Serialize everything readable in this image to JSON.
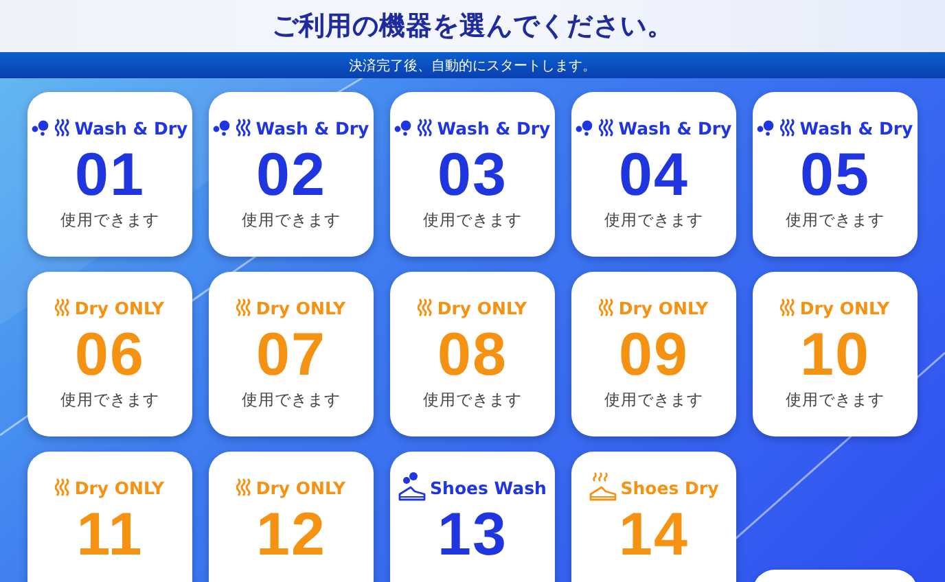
{
  "title": "ご利用の機器を選んでください。",
  "notice": "決済完了後、自動的にスタートします。",
  "machines": [
    {
      "kind": "wash_dry",
      "label": "Wash & Dry",
      "number": "01",
      "status": "使用できます"
    },
    {
      "kind": "wash_dry",
      "label": "Wash & Dry",
      "number": "02",
      "status": "使用できます"
    },
    {
      "kind": "wash_dry",
      "label": "Wash & Dry",
      "number": "03",
      "status": "使用できます"
    },
    {
      "kind": "wash_dry",
      "label": "Wash & Dry",
      "number": "04",
      "status": "使用できます"
    },
    {
      "kind": "wash_dry",
      "label": "Wash & Dry",
      "number": "05",
      "status": "使用できます"
    },
    {
      "kind": "dry_only",
      "label": "Dry ONLY",
      "number": "06",
      "status": "使用できます"
    },
    {
      "kind": "dry_only",
      "label": "Dry ONLY",
      "number": "07",
      "status": "使用できます"
    },
    {
      "kind": "dry_only",
      "label": "Dry ONLY",
      "number": "08",
      "status": "使用できます"
    },
    {
      "kind": "dry_only",
      "label": "Dry ONLY",
      "number": "09",
      "status": "使用できます"
    },
    {
      "kind": "dry_only",
      "label": "Dry ONLY",
      "number": "10",
      "status": "使用できます"
    },
    {
      "kind": "dry_only",
      "label": "Dry ONLY",
      "number": "11"
    },
    {
      "kind": "dry_only",
      "label": "Dry ONLY",
      "number": "12"
    },
    {
      "kind": "shoes_wash",
      "label": "Shoes Wash",
      "number": "13"
    },
    {
      "kind": "shoes_dry",
      "label": "Shoes Dry",
      "number": "14"
    },
    {
      "kind": "empty"
    }
  ]
}
